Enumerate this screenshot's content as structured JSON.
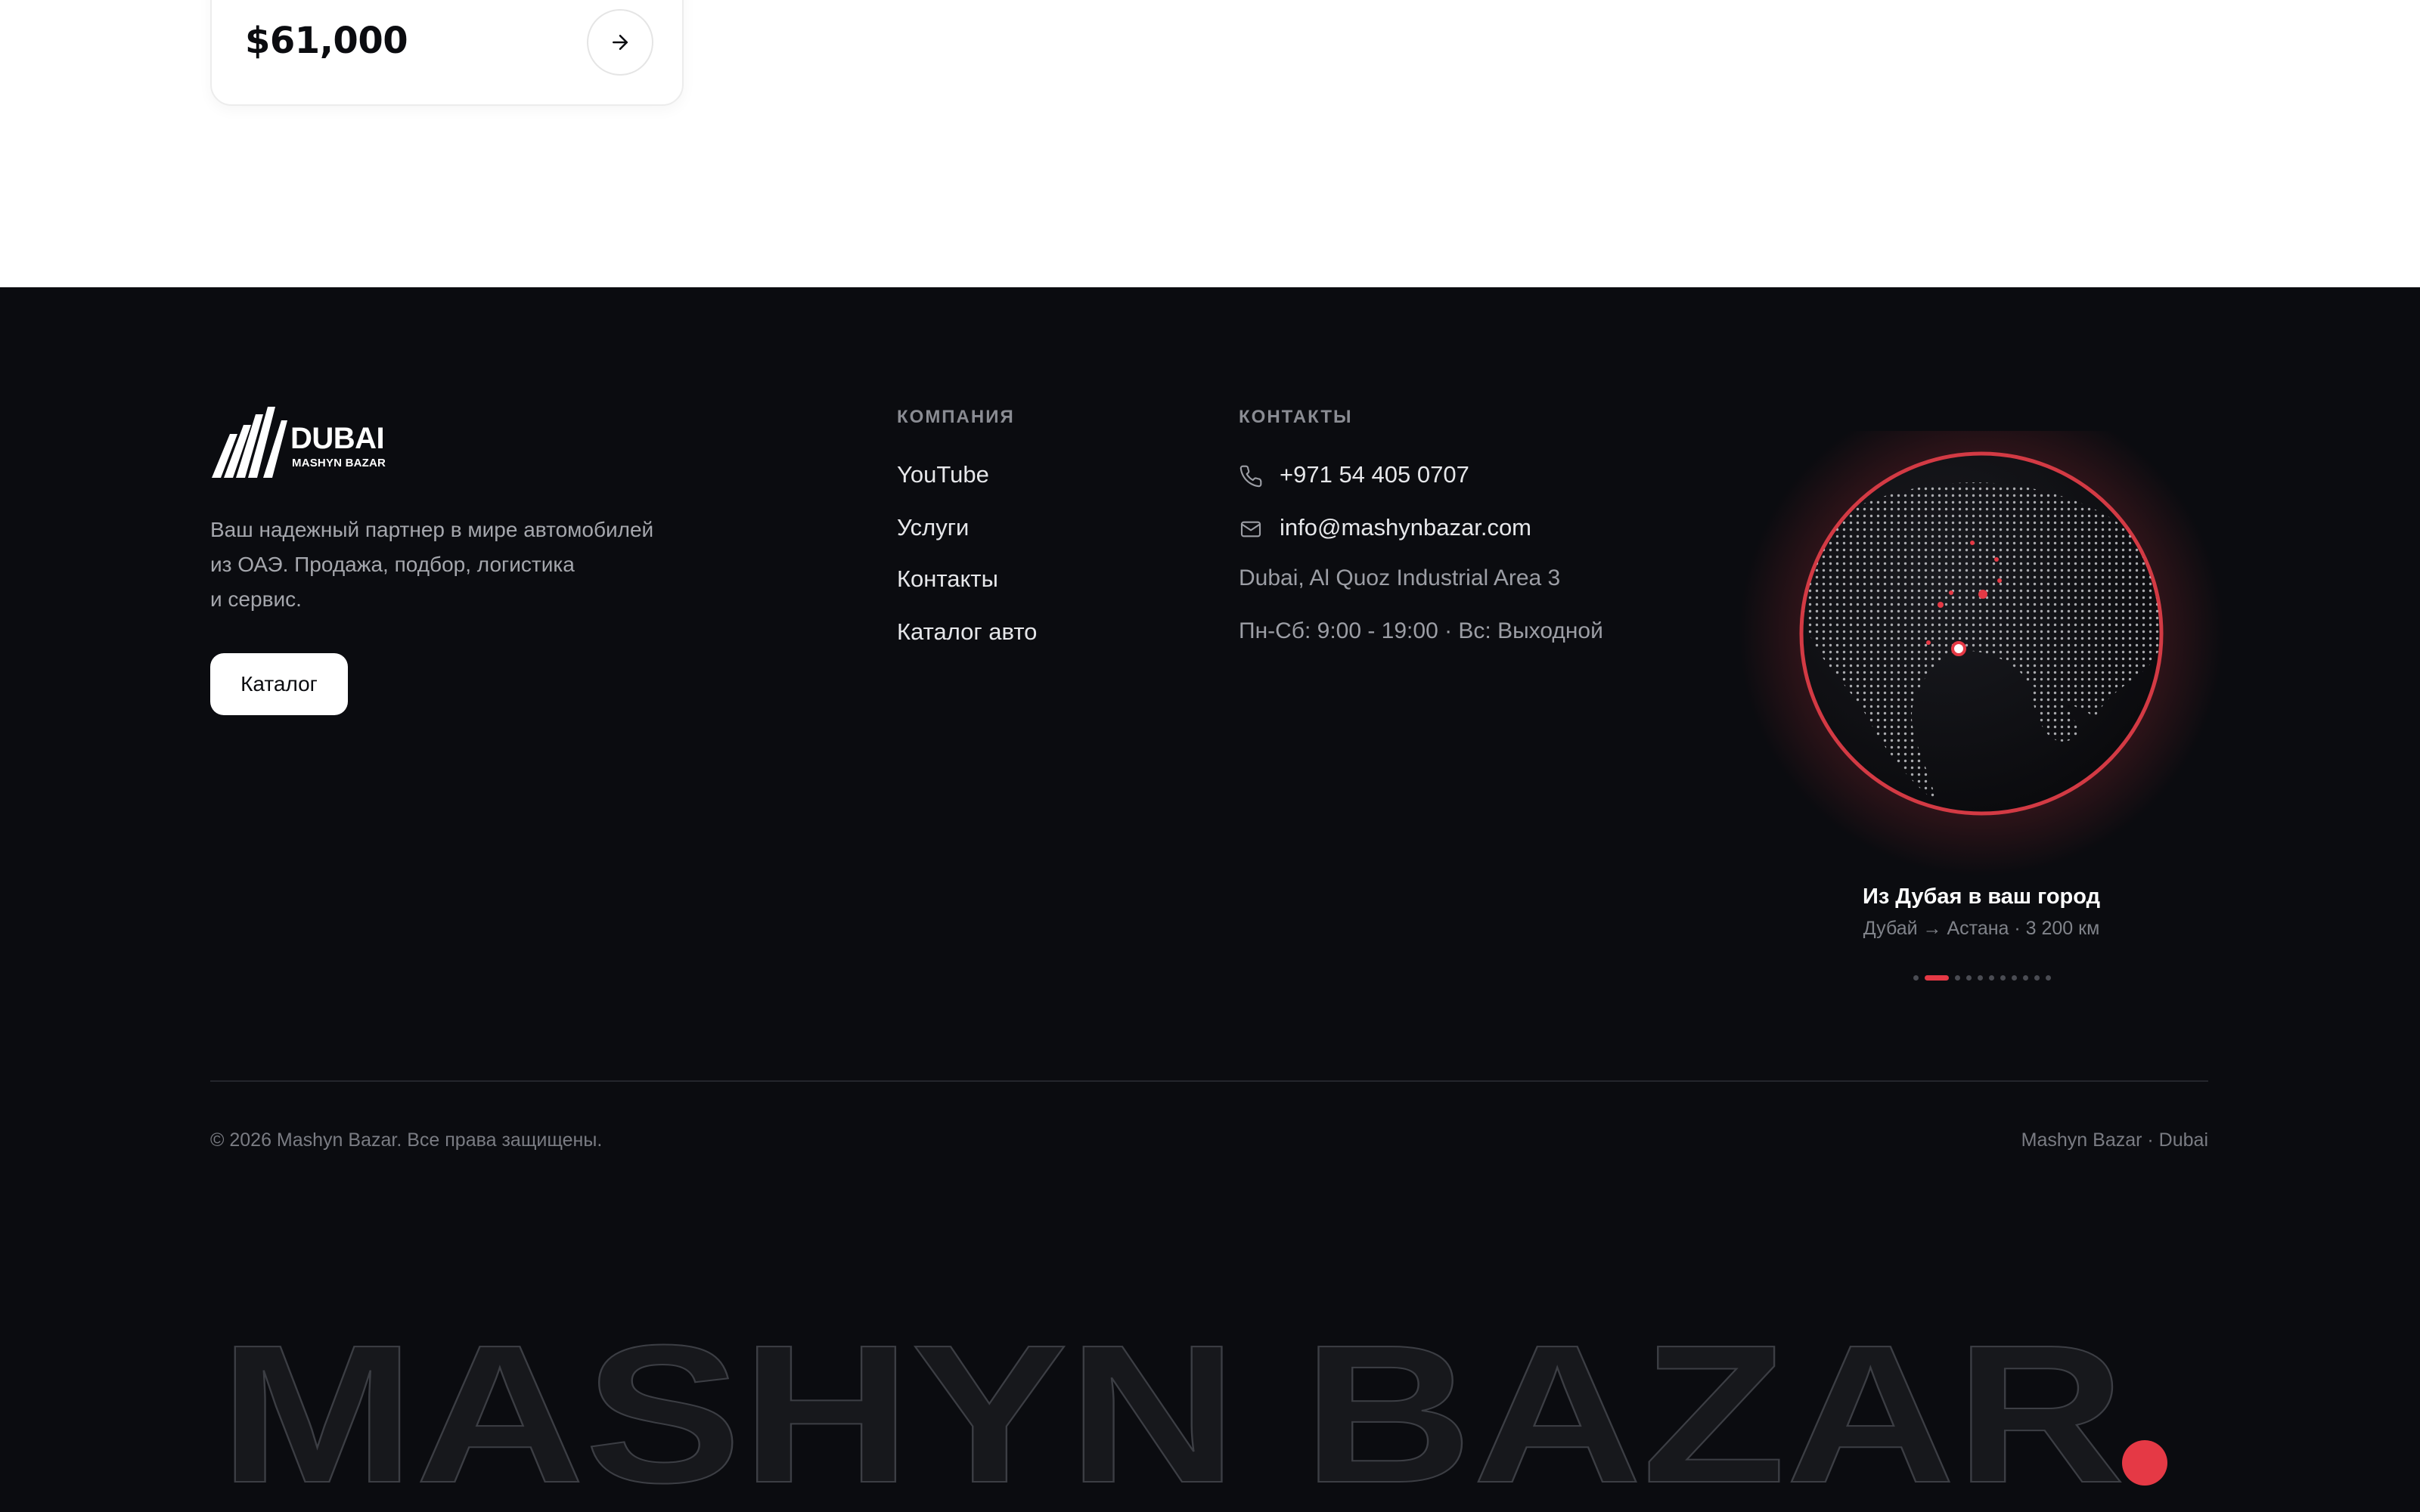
{
  "card": {
    "price": "$61,000",
    "arrow_icon": "arrow-right-icon"
  },
  "logo": {
    "title": "DUBAI",
    "subtitle": "MASHYN BAZAR"
  },
  "about": {
    "lines": [
      "Ваш надежный партнер в мире автомобилей",
      "из ОАЭ. Продажа, подбор, логистика",
      "и сервис."
    ],
    "button_label": "Каталог"
  },
  "company": {
    "title": "КОМПАНИЯ",
    "links": [
      "YouTube",
      "Услуги",
      "Контакты",
      "Каталог авто"
    ]
  },
  "contacts": {
    "title": "КОНТАКТЫ",
    "phone": "+971 54 405 0707",
    "email": "info@mashynbazar.com",
    "address": "Dubai, Al Quoz Industrial Area 3",
    "hours": "Пн-Сб: 9:00 - 19:00 · Вс: Выходной"
  },
  "globe": {
    "title": "Из Дубая в ваш город",
    "subtitle": "Дубай → Астана · 3 200 км",
    "slide_count": 11,
    "active_slide": 1,
    "accent_color": "#e53945"
  },
  "footer_bottom": {
    "copyright": "© 2026 Mashyn Bazar. Все права защищены.",
    "brand": "Mashyn Bazar · Dubai"
  },
  "big_brand": {
    "text": "MASHYN BAZAR",
    "dot_color": "#e53945"
  }
}
